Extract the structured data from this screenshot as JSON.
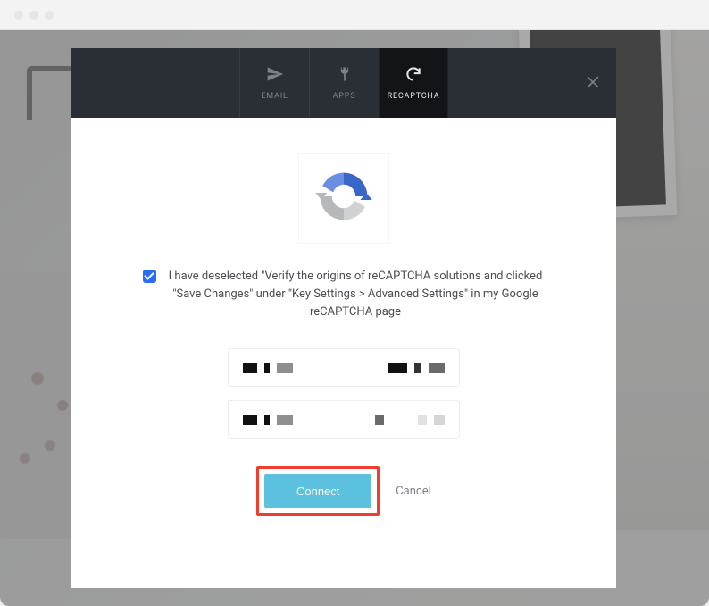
{
  "tabs": {
    "email": "EMAIL",
    "apps": "APPS",
    "recaptcha": "RECAPTCHA"
  },
  "consent": {
    "text": "I have deselected \"Verify the origins of reCAPTCHA solutions and clicked \"Save Changes\" under \"Key Settings > Advanced Settings\" in my Google reCAPTCHA page",
    "checked": true
  },
  "actions": {
    "connect": "Connect",
    "cancel": "Cancel"
  },
  "colors": {
    "accent": "#5bc1de",
    "highlight": "#ef3e2e",
    "checkbox": "#2a6df4"
  }
}
